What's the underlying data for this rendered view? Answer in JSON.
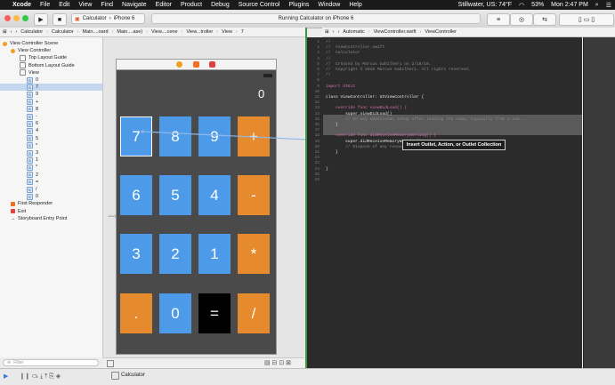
{
  "menubar": {
    "app": "Xcode",
    "items": [
      "File",
      "Edit",
      "View",
      "Find",
      "Navigate",
      "Editor",
      "Product",
      "Debug",
      "Source Control",
      "Plugins",
      "Window",
      "Help"
    ],
    "weather": "Stillwater, US: 74°F",
    "battery": "53%",
    "clock": "Mon 2:47 PM"
  },
  "toolbar": {
    "scheme_app": "Calculator",
    "scheme_device": "iPhone 6",
    "activity": "Running Calculator on iPhone 6"
  },
  "jumpbar_left": [
    "Calculator",
    "Calculator",
    "Main....oard",
    "Main....ase)",
    "View....cene",
    "View...troller",
    "View",
    "7"
  ],
  "jumpbar_right": [
    "Automatic",
    "ViewController.swift",
    "ViewController"
  ],
  "navigator": {
    "scene": "View Controller Scene",
    "controller": "View Controller",
    "top_guide": "Top Layout Guide",
    "bottom_guide": "Bottom Layout Guide",
    "view": "View",
    "labels": [
      "0",
      "7",
      "9",
      "+",
      "8",
      "-",
      "6",
      "4",
      "5",
      "*",
      "3",
      "1",
      "*",
      "2",
      "=",
      "/",
      "0"
    ],
    "first_responder": "First Responder",
    "exit": "Exit",
    "entry": "Storyboard Entry Point",
    "filter_placeholder": "Filter"
  },
  "calculator": {
    "display": "0",
    "keys": [
      {
        "label": "7",
        "color": "blue"
      },
      {
        "label": "8",
        "color": "blue"
      },
      {
        "label": "9",
        "color": "blue"
      },
      {
        "label": "+",
        "color": "orange"
      },
      {
        "label": "6",
        "color": "blue"
      },
      {
        "label": "5",
        "color": "blue"
      },
      {
        "label": "4",
        "color": "blue"
      },
      {
        "label": "-",
        "color": "orange"
      },
      {
        "label": "3",
        "color": "blue"
      },
      {
        "label": "2",
        "color": "blue"
      },
      {
        "label": "1",
        "color": "blue"
      },
      {
        "label": "*",
        "color": "orange"
      },
      {
        "label": ".",
        "color": "orange"
      },
      {
        "label": "0",
        "color": "blue"
      },
      {
        "label": "=",
        "color": "black"
      },
      {
        "label": "/",
        "color": "orange"
      }
    ]
  },
  "code": {
    "line_numbers": [
      "1",
      "2",
      "3",
      "4",
      "5",
      "6",
      "7",
      "8",
      "9",
      "10",
      "11",
      "12",
      "13",
      "14",
      "15",
      "16",
      "17",
      "18",
      "19",
      "20",
      "21",
      "22",
      "23",
      "24",
      "25",
      "26"
    ],
    "lines": [
      {
        "text": "//",
        "cls": "c-com"
      },
      {
        "text": "//  ViewController.swift",
        "cls": "c-com"
      },
      {
        "text": "//  Calculator",
        "cls": "c-com"
      },
      {
        "text": "//",
        "cls": "c-com"
      },
      {
        "text": "//  Created by Marcus Gabilheri on 2/18/16.",
        "cls": "c-com"
      },
      {
        "text": "//  Copyright © 2016 Marcus Gabilheri. All rights reserved.",
        "cls": "c-com"
      },
      {
        "text": "//",
        "cls": "c-com"
      },
      {
        "text": "",
        "cls": "c-pl"
      },
      {
        "text": "import UIKit",
        "cls": "c-kw"
      },
      {
        "text": "",
        "cls": "c-pl"
      },
      {
        "text": "class ViewController: UIViewController {",
        "cls": "c-pl"
      },
      {
        "text": "",
        "cls": "c-pl"
      },
      {
        "text": "    override func viewDidLoad() {",
        "cls": "c-kw"
      },
      {
        "text": "        super.viewDidLoad()",
        "cls": "c-pl"
      },
      {
        "text": "        // Do any additional setup after loading the view, typically from a nib.",
        "cls": "c-com"
      },
      {
        "text": "    }",
        "cls": "c-pl"
      },
      {
        "text": "",
        "cls": "c-pl"
      },
      {
        "text": "    override func didReceiveMemoryWarning() {",
        "cls": "c-kw"
      },
      {
        "text": "        super.didReceiveMemoryWarning()",
        "cls": "c-pl"
      },
      {
        "text": "        // Dispose of any resources that can be recreated.",
        "cls": "c-com"
      },
      {
        "text": "    }",
        "cls": "c-pl"
      },
      {
        "text": "",
        "cls": "c-pl"
      },
      {
        "text": "",
        "cls": "c-pl"
      },
      {
        "text": "}",
        "cls": "c-pl"
      },
      {
        "text": "",
        "cls": "c-pl"
      },
      {
        "text": "",
        "cls": "c-pl"
      }
    ]
  },
  "tooltip": "Insert Outlet, Action, or Outlet Collection",
  "debug_bar": {
    "target": "Calculator"
  }
}
